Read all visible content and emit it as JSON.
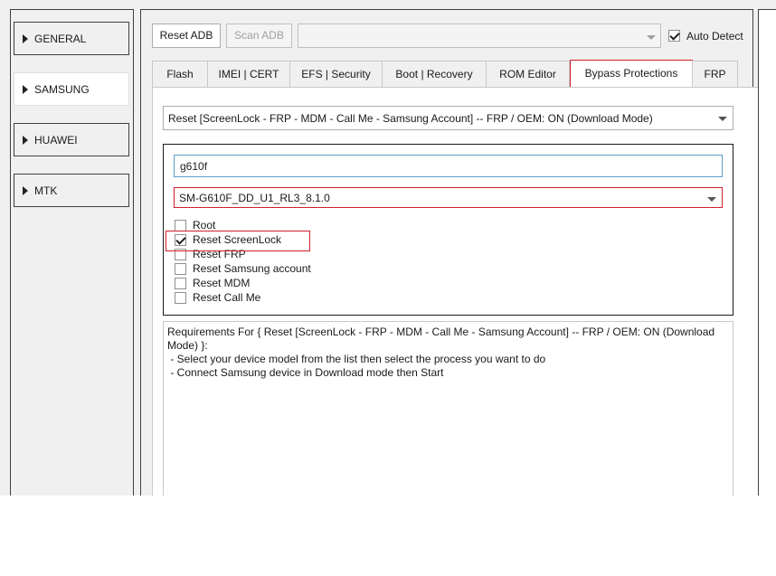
{
  "sidebar": {
    "items": [
      {
        "label": "GENERAL",
        "selected": false
      },
      {
        "label": "SAMSUNG",
        "selected": true
      },
      {
        "label": "HUAWEI",
        "selected": false
      },
      {
        "label": "MTK",
        "selected": false
      }
    ]
  },
  "toolbar": {
    "reset_adb": "Reset ADB",
    "scan_adb": "Scan ADB",
    "device_combo_value": "",
    "auto_detect_label": "Auto Detect",
    "auto_detect_checked": true
  },
  "tabs": [
    {
      "label": "Flash"
    },
    {
      "label": "IMEI | CERT"
    },
    {
      "label": "EFS | Security"
    },
    {
      "label": "Boot | Recovery"
    },
    {
      "label": "ROM Editor"
    },
    {
      "label": "Bypass Protections",
      "active": true
    },
    {
      "label": "FRP"
    }
  ],
  "bypass": {
    "operation_value": "Reset [ScreenLock - FRP - MDM - Call Me - Samsung Account] -- FRP / OEM: ON (Download Mode)",
    "model_search_value": "g610f",
    "firmware_value": "SM-G610F_DD_U1_RL3_8.1.0",
    "options": [
      {
        "label": "Root",
        "checked": false
      },
      {
        "label": "Reset ScreenLock",
        "checked": true
      },
      {
        "label": "Reset FRP",
        "checked": false
      },
      {
        "label": "Reset Samsung account",
        "checked": false
      },
      {
        "label": "Reset MDM",
        "checked": false
      },
      {
        "label": "Reset Call Me",
        "checked": false
      }
    ],
    "requirements_text": "Requirements For { Reset [ScreenLock - FRP - MDM - Call Me - Samsung Account] -- FRP / OEM: ON (Download Mode) }:\n - Select your device model from the list then select the process you want to do\n - Connect Samsung device in Download mode then Start"
  },
  "colors": {
    "highlight": "#d0202a",
    "input_focus": "#5aa0c8"
  }
}
